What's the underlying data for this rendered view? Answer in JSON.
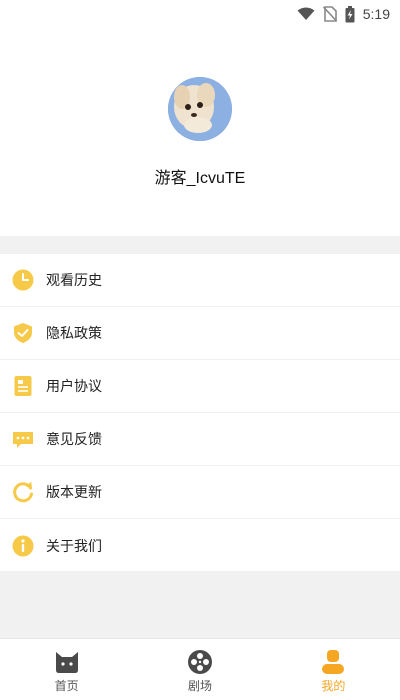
{
  "status_bar": {
    "time": "5:19"
  },
  "profile": {
    "username": "游客_IcvuTE"
  },
  "menu": {
    "items": [
      {
        "label": "观看历史",
        "icon": "clock-icon"
      },
      {
        "label": "隐私政策",
        "icon": "shield-check-icon"
      },
      {
        "label": "用户协议",
        "icon": "document-icon"
      },
      {
        "label": "意见反馈",
        "icon": "chat-dots-icon"
      },
      {
        "label": "版本更新",
        "icon": "refresh-icon"
      },
      {
        "label": "关于我们",
        "icon": "info-icon"
      }
    ]
  },
  "tabbar": {
    "tabs": [
      {
        "label": "首页",
        "icon": "cat-face-icon",
        "active": false
      },
      {
        "label": "剧场",
        "icon": "film-reel-icon",
        "active": false
      },
      {
        "label": "我的",
        "icon": "person-icon",
        "active": true
      }
    ]
  },
  "colors": {
    "accent": "#f5a623",
    "icon_yellow": "#f7c948",
    "background_gray": "#f1f1f1"
  }
}
